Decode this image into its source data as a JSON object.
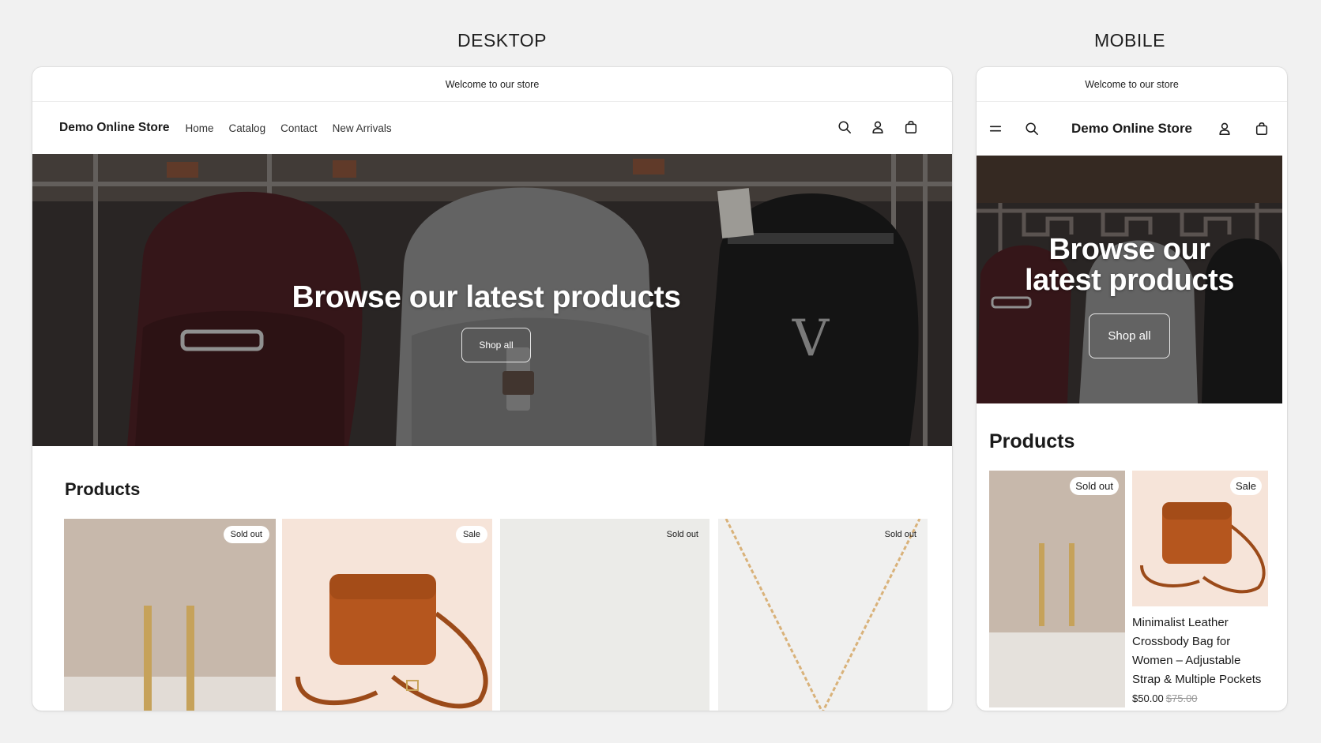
{
  "labels": {
    "desktop": "DESKTOP",
    "mobile": "MOBILE"
  },
  "announcement": "Welcome to our store",
  "store_name": "Demo Online Store",
  "nav": [
    "Home",
    "Catalog",
    "Contact",
    "New Arrivals"
  ],
  "icons": [
    "search-icon",
    "account-icon",
    "cart-icon",
    "menu-icon"
  ],
  "hero": {
    "title": "Browse our latest products",
    "mobile_title_line1": "Browse our",
    "mobile_title_line2": "latest products",
    "button": "Shop all"
  },
  "products_title": "Products",
  "products": [
    {
      "badge": "Sold out"
    },
    {
      "badge": "Sale",
      "name": "Minimalist Leather Crossbody Bag for Women – Adjustable Strap & Multiple Pockets",
      "price": "$50.00",
      "compare_price": "$75.00"
    },
    {
      "badge": "Sold out"
    },
    {
      "badge": "Sold out"
    }
  ],
  "colors": {
    "page_bg": "#f1f1f1",
    "bag_leather": "#b5561e",
    "earring_bg": "#c7b8ab",
    "bag_bg": "#f6e4d9",
    "plain_bg": "#ebebe8",
    "necklace_bg": "#f0f0ef"
  }
}
